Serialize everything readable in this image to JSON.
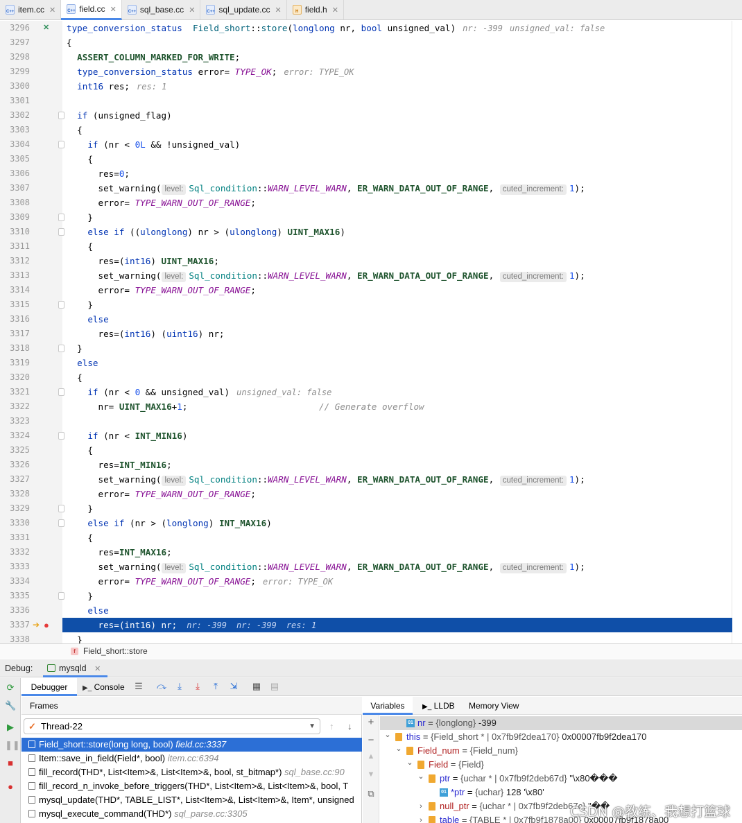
{
  "tabs": [
    {
      "label": "item.cc",
      "kind": "cc",
      "icon": "cpp-file-icon"
    },
    {
      "label": "field.cc",
      "kind": "cc",
      "icon": "cpp-file-icon",
      "active": true
    },
    {
      "label": "sql_base.cc",
      "kind": "cc",
      "icon": "cpp-file-icon"
    },
    {
      "label": "sql_update.cc",
      "kind": "cc",
      "icon": "cpp-file-icon"
    },
    {
      "label": "field.h",
      "kind": "h",
      "icon": "header-file-icon"
    }
  ],
  "tab_icon_cc_text": "C++",
  "tab_icon_h_text": "H",
  "code_lines": [
    {
      "n": "3296",
      "mark": "collapse",
      "s": [
        [
          "ty",
          "type_conversion_status"
        ],
        [
          "",
          "  "
        ],
        [
          "fn",
          "Field_short"
        ],
        [
          "",
          "::"
        ],
        [
          "fn",
          "store"
        ],
        [
          "",
          "("
        ],
        [
          "ty",
          "longlong"
        ],
        [
          "",
          " nr, "
        ],
        [
          "kw",
          "bool"
        ],
        [
          "",
          " unsigned_val)"
        ],
        [
          "hint",
          "nr: -399"
        ],
        [
          "hint",
          "unsigned_val: false"
        ]
      ],
      "raw": true
    },
    {
      "n": "3297",
      "s": [
        [
          "",
          "{"
        ]
      ]
    },
    {
      "n": "3298",
      "s": [
        [
          "",
          "  "
        ],
        [
          "mc",
          "ASSERT_COLUMN_MARKED_FOR_WRITE"
        ],
        [
          "",
          ";"
        ]
      ]
    },
    {
      "n": "3299",
      "s": [
        [
          "",
          "  "
        ],
        [
          "ty",
          "type_conversion_status"
        ],
        [
          "",
          " error= "
        ],
        [
          "cn",
          "TYPE_OK"
        ],
        [
          "",
          ";"
        ],
        [
          "hint",
          "error: TYPE_OK"
        ]
      ]
    },
    {
      "n": "3300",
      "s": [
        [
          "",
          "  "
        ],
        [
          "ty",
          "int16"
        ],
        [
          "",
          " res;"
        ],
        [
          "hint",
          "res: 1"
        ]
      ]
    },
    {
      "n": "3301",
      "s": []
    },
    {
      "n": "3302",
      "fold": true,
      "s": [
        [
          "",
          "  "
        ],
        [
          "kw",
          "if"
        ],
        [
          "",
          " (unsigned_flag)"
        ]
      ]
    },
    {
      "n": "3303",
      "s": [
        [
          "",
          "  {"
        ]
      ]
    },
    {
      "n": "3304",
      "fold": true,
      "s": [
        [
          "",
          "    "
        ],
        [
          "kw",
          "if"
        ],
        [
          "",
          " (nr < "
        ],
        [
          "nm",
          "0L"
        ],
        [
          "",
          " && !unsigned_val)"
        ]
      ]
    },
    {
      "n": "3305",
      "s": [
        [
          "",
          "    {"
        ]
      ]
    },
    {
      "n": "3306",
      "s": [
        [
          "",
          "      res="
        ],
        [
          "nm",
          "0"
        ],
        [
          "",
          ";"
        ]
      ]
    },
    {
      "n": "3307",
      "s": [
        [
          "",
          "      set_warning("
        ],
        [
          "ph",
          "level:"
        ],
        [
          "ns",
          "Sql_condition"
        ],
        [
          "",
          "::"
        ],
        [
          "cn",
          "WARN_LEVEL_WARN"
        ],
        [
          "",
          ", "
        ],
        [
          "mc",
          "ER_WARN_DATA_OUT_OF_RANGE"
        ],
        [
          "",
          ", "
        ],
        [
          "ph",
          "cuted_increment:"
        ],
        [
          "nm",
          "1"
        ],
        [
          "",
          ");"
        ]
      ]
    },
    {
      "n": "3308",
      "s": [
        [
          "",
          "      error= "
        ],
        [
          "cn",
          "TYPE_WARN_OUT_OF_RANGE"
        ],
        [
          "",
          ";"
        ]
      ]
    },
    {
      "n": "3309",
      "fold": true,
      "s": [
        [
          "",
          "    }"
        ]
      ]
    },
    {
      "n": "3310",
      "fold": true,
      "s": [
        [
          "",
          "    "
        ],
        [
          "kw",
          "else if"
        ],
        [
          "",
          " (("
        ],
        [
          "ty",
          "ulonglong"
        ],
        [
          "",
          ") nr > ("
        ],
        [
          "ty",
          "ulonglong"
        ],
        [
          "",
          ") "
        ],
        [
          "mc",
          "UINT_MAX16"
        ],
        [
          "",
          ")"
        ]
      ]
    },
    {
      "n": "3311",
      "s": [
        [
          "",
          "    {"
        ]
      ]
    },
    {
      "n": "3312",
      "s": [
        [
          "",
          "      res=("
        ],
        [
          "ty",
          "int16"
        ],
        [
          "",
          ") "
        ],
        [
          "mc",
          "UINT_MAX16"
        ],
        [
          "",
          ";"
        ]
      ]
    },
    {
      "n": "3313",
      "s": [
        [
          "",
          "      set_warning("
        ],
        [
          "ph",
          "level:"
        ],
        [
          "ns",
          "Sql_condition"
        ],
        [
          "",
          "::"
        ],
        [
          "cn",
          "WARN_LEVEL_WARN"
        ],
        [
          "",
          ", "
        ],
        [
          "mc",
          "ER_WARN_DATA_OUT_OF_RANGE"
        ],
        [
          "",
          ", "
        ],
        [
          "ph",
          "cuted_increment:"
        ],
        [
          "nm",
          "1"
        ],
        [
          "",
          ");"
        ]
      ]
    },
    {
      "n": "3314",
      "s": [
        [
          "",
          "      error= "
        ],
        [
          "cn",
          "TYPE_WARN_OUT_OF_RANGE"
        ],
        [
          "",
          ";"
        ]
      ]
    },
    {
      "n": "3315",
      "fold": true,
      "s": [
        [
          "",
          "    }"
        ]
      ]
    },
    {
      "n": "3316",
      "s": [
        [
          "",
          "    "
        ],
        [
          "kw",
          "else"
        ]
      ]
    },
    {
      "n": "3317",
      "s": [
        [
          "",
          "      res=("
        ],
        [
          "ty",
          "int16"
        ],
        [
          "",
          ") ("
        ],
        [
          "ty",
          "uint16"
        ],
        [
          "",
          ") nr;"
        ]
      ]
    },
    {
      "n": "3318",
      "fold": true,
      "s": [
        [
          "",
          "  }"
        ]
      ]
    },
    {
      "n": "3319",
      "s": [
        [
          "",
          "  "
        ],
        [
          "kw",
          "else"
        ]
      ]
    },
    {
      "n": "3320",
      "s": [
        [
          "",
          "  {"
        ]
      ]
    },
    {
      "n": "3321",
      "fold": true,
      "s": [
        [
          "",
          "    "
        ],
        [
          "kw",
          "if"
        ],
        [
          "",
          " (nr < "
        ],
        [
          "nm",
          "0"
        ],
        [
          "",
          " && unsigned_val)"
        ],
        [
          "hint",
          "unsigned_val: false"
        ]
      ]
    },
    {
      "n": "3322",
      "s": [
        [
          "",
          "      nr= "
        ],
        [
          "mc",
          "UINT_MAX16"
        ],
        [
          "",
          "+"
        ],
        [
          "nm",
          "1"
        ],
        [
          "",
          ";                         "
        ],
        [
          "cm",
          "// Generate overflow"
        ]
      ]
    },
    {
      "n": "3323",
      "s": []
    },
    {
      "n": "3324",
      "fold": true,
      "s": [
        [
          "",
          "    "
        ],
        [
          "kw",
          "if"
        ],
        [
          "",
          " (nr < "
        ],
        [
          "mc",
          "INT_MIN16"
        ],
        [
          "",
          ")"
        ]
      ]
    },
    {
      "n": "3325",
      "s": [
        [
          "",
          "    {"
        ]
      ]
    },
    {
      "n": "3326",
      "s": [
        [
          "",
          "      res="
        ],
        [
          "mc",
          "INT_MIN16"
        ],
        [
          "",
          ";"
        ]
      ]
    },
    {
      "n": "3327",
      "s": [
        [
          "",
          "      set_warning("
        ],
        [
          "ph",
          "level:"
        ],
        [
          "ns",
          "Sql_condition"
        ],
        [
          "",
          "::"
        ],
        [
          "cn",
          "WARN_LEVEL_WARN"
        ],
        [
          "",
          ", "
        ],
        [
          "mc",
          "ER_WARN_DATA_OUT_OF_RANGE"
        ],
        [
          "",
          ", "
        ],
        [
          "ph",
          "cuted_increment:"
        ],
        [
          "nm",
          "1"
        ],
        [
          "",
          ");"
        ]
      ]
    },
    {
      "n": "3328",
      "s": [
        [
          "",
          "      error= "
        ],
        [
          "cn",
          "TYPE_WARN_OUT_OF_RANGE"
        ],
        [
          "",
          ";"
        ]
      ]
    },
    {
      "n": "3329",
      "fold": true,
      "s": [
        [
          "",
          "    }"
        ]
      ]
    },
    {
      "n": "3330",
      "fold": true,
      "s": [
        [
          "",
          "    "
        ],
        [
          "kw",
          "else if"
        ],
        [
          "",
          " (nr > ("
        ],
        [
          "ty",
          "longlong"
        ],
        [
          "",
          ") "
        ],
        [
          "mc",
          "INT_MAX16"
        ],
        [
          "",
          ")"
        ]
      ]
    },
    {
      "n": "3331",
      "s": [
        [
          "",
          "    {"
        ]
      ]
    },
    {
      "n": "3332",
      "s": [
        [
          "",
          "      res="
        ],
        [
          "mc",
          "INT_MAX16"
        ],
        [
          "",
          ";"
        ]
      ]
    },
    {
      "n": "3333",
      "s": [
        [
          "",
          "      set_warning("
        ],
        [
          "ph",
          "level:"
        ],
        [
          "ns",
          "Sql_condition"
        ],
        [
          "",
          "::"
        ],
        [
          "cn",
          "WARN_LEVEL_WARN"
        ],
        [
          "",
          ", "
        ],
        [
          "mc",
          "ER_WARN_DATA_OUT_OF_RANGE"
        ],
        [
          "",
          ", "
        ],
        [
          "ph",
          "cuted_increment:"
        ],
        [
          "nm",
          "1"
        ],
        [
          "",
          ");"
        ]
      ]
    },
    {
      "n": "3334",
      "s": [
        [
          "",
          "      error= "
        ],
        [
          "cn",
          "TYPE_WARN_OUT_OF_RANGE"
        ],
        [
          "",
          ";"
        ],
        [
          "hint",
          "error: TYPE_OK"
        ]
      ]
    },
    {
      "n": "3335",
      "fold": true,
      "s": [
        [
          "",
          "    }"
        ]
      ]
    },
    {
      "n": "3336",
      "s": [
        [
          "",
          "    "
        ],
        [
          "kw",
          "else"
        ]
      ]
    },
    {
      "n": "3337",
      "mark": "breakpoint",
      "current": true,
      "s": [
        [
          "",
          "      res=(int16) nr;"
        ],
        [
          "hint",
          "nr: -399"
        ],
        [
          "hint",
          "nr: -399"
        ],
        [
          "hint",
          "res: 1"
        ]
      ]
    },
    {
      "n": "3338",
      "s": [
        [
          "",
          "  }"
        ]
      ]
    }
  ],
  "breadcrumb": {
    "badge": "f",
    "label": "Field_short::store"
  },
  "debug_bar": {
    "label": "Debug:",
    "session": "mysqld"
  },
  "debugger_tabs": {
    "debugger": "Debugger",
    "console": "Console"
  },
  "frames": {
    "header": "Frames",
    "thread": "Thread-22",
    "items": [
      {
        "fn": "Field_short::store(long long, bool)",
        "loc": "field.cc:3337",
        "sel": true
      },
      {
        "fn": "Item::save_in_field(Field*, bool)",
        "loc": "item.cc:6394"
      },
      {
        "fn": "fill_record(THD*, List<Item>&, List<Item>&, bool, st_bitmap*)",
        "loc": "sql_base.cc:90"
      },
      {
        "fn": "fill_record_n_invoke_before_triggers(THD*, List<Item>&, List<Item>&, bool, T",
        "loc": ""
      },
      {
        "fn": "mysql_update(THD*, TABLE_LIST*, List<Item>&, List<Item>&, Item*, unsigned",
        "loc": ""
      },
      {
        "fn": "mysql_execute_command(THD*)",
        "loc": "sql_parse.cc:3305"
      }
    ]
  },
  "var_tabs": {
    "variables": "Variables",
    "lldb": "LLDB",
    "memory": "Memory View"
  },
  "variables": [
    {
      "tw": "",
      "icon": "ico1",
      "name": "nr",
      "type": "{longlong}",
      "value": "-399",
      "sel": true
    },
    {
      "tw": "open",
      "icon": "field",
      "name": "this",
      "type": "{Field_short * | 0x7fb9f2dea170}",
      "value": "0x00007fb9f2dea170"
    },
    {
      "tw": "open",
      "icon": "field",
      "name": "Field_num",
      "type": "{Field_num}",
      "value": "",
      "red": true
    },
    {
      "tw": "open",
      "icon": "field",
      "name": "Field",
      "type": "{Field}",
      "value": "",
      "red": true
    },
    {
      "tw": "open",
      "icon": "field",
      "name": "ptr",
      "type": "{uchar * | 0x7fb9f2deb67d}",
      "value": "\"\\x80���"
    },
    {
      "tw": "",
      "icon": "ico1",
      "name": "*ptr",
      "type": "{uchar}",
      "value": "128 '\\x80'"
    },
    {
      "tw": "closed",
      "icon": "field",
      "name": "null_ptr",
      "type": "{uchar * | 0x7fb9f2deb67c}",
      "value": "\"��",
      "red": true
    },
    {
      "tw": "closed",
      "icon": "field",
      "name": "table",
      "type": "{TABLE * | 0x7fb9f1878a00}",
      "value": "0x00007fb9f1878a00"
    }
  ],
  "watermark": "CSDN @教练、我想打篮球",
  "colors": {
    "accent": "#4a88e8",
    "current_line": "#0f4fa8",
    "frame_selected": "#2c6fd6",
    "keyword": "#0033b3",
    "constant": "#871094",
    "macro": "#1f542e",
    "number": "#1750eb"
  }
}
